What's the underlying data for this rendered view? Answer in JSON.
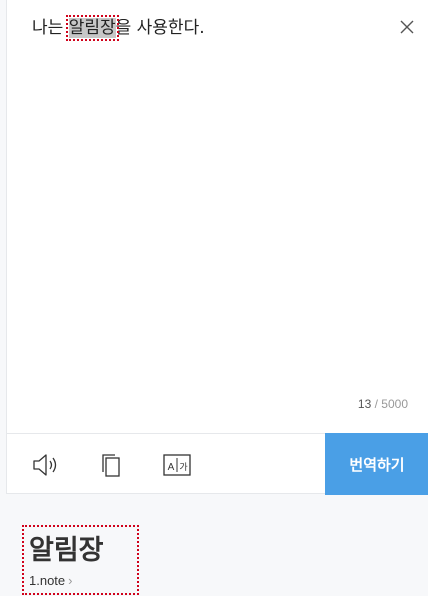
{
  "source": {
    "before": "나는 ",
    "highlight": "알림장",
    "after": "을 사용한다."
  },
  "counter": {
    "current": "13",
    "separator": " / ",
    "max": "5000"
  },
  "toolbar": {
    "icons": [
      "speaker-icon",
      "copy-icon",
      "dictionary-icon"
    ],
    "translate_label": "번역하기"
  },
  "result": {
    "word": "알림장",
    "meaning": "1.note",
    "arrow": "›"
  },
  "colors": {
    "accent": "#4a9fe6",
    "highlight": "#c7c7c7",
    "annotation": "#d0021b"
  }
}
